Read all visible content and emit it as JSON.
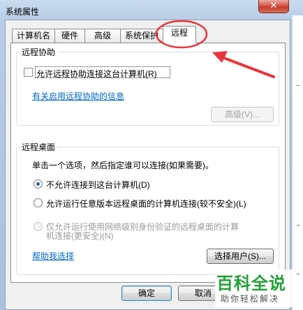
{
  "window": {
    "title": "系统属性",
    "close_glyph": "✕"
  },
  "tabs": [
    {
      "label": "计算机名",
      "active": false
    },
    {
      "label": "硬件",
      "active": false
    },
    {
      "label": "高级",
      "active": false
    },
    {
      "label": "系统保护",
      "active": false
    },
    {
      "label": "远程",
      "active": true
    }
  ],
  "remote_assistance": {
    "group_title": "远程协助",
    "checkbox_label": "允许远程协助连接这台计算机(R)",
    "checkbox_checked": false,
    "info_link": "有关启用远程协助的信息",
    "advanced_button": "高级(V)..."
  },
  "remote_desktop": {
    "group_title": "远程桌面",
    "instruction": "单击一个选项，然后指定谁可以连接(如果需要)。",
    "options": [
      {
        "label": "不允许连接到这台计算机(D)",
        "checked": true,
        "enabled": true
      },
      {
        "label": "允许运行任意版本远程桌面的计算机连接(较不安全)(L)",
        "checked": false,
        "enabled": true
      },
      {
        "label_line1": "仅允许运行使用网络级别身份验证的远程桌面的计算",
        "label_line2": "机连接(更安全)(N)",
        "checked": false,
        "enabled": false
      }
    ],
    "help_link": "帮助我选择",
    "select_users_button": "选择用户(S)..."
  },
  "footer": {
    "ok_button": "确定",
    "cancel_button": "取消"
  },
  "watermark": {
    "main": "百科全说",
    "sub": "助你轻松解决"
  },
  "colors": {
    "annotation": "#e8353a",
    "link": "#0066cc",
    "watermark_green": "#22a038"
  },
  "icons": [
    "close-icon"
  ]
}
